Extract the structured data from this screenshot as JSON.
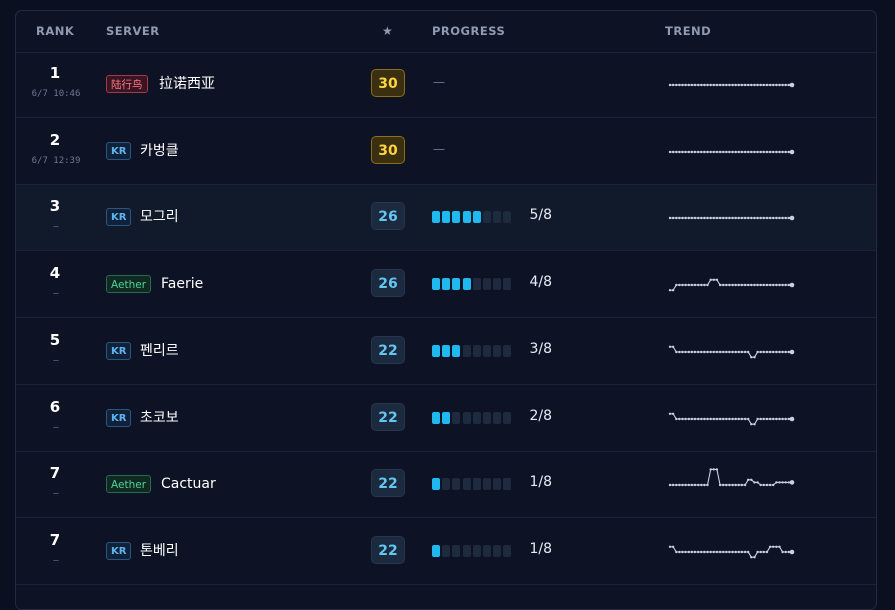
{
  "header": {
    "rank": "RANK",
    "server": "SERVER",
    "star": "★",
    "progress": "PROGRESS",
    "trend": "TREND"
  },
  "colors": {
    "bar_on": "#1fb8ef",
    "bar_off": "#1e2a3e",
    "trend_line": "#c9d0de",
    "gold": "#ffd23f",
    "blue": "#62c6ef"
  },
  "rows": [
    {
      "rank": "1",
      "time": "6/7 10:46",
      "badge": "陆行鸟",
      "badge_type": "cn",
      "server": "拉诺西亚",
      "score": "30",
      "score_type": "gold",
      "progress_text": "—",
      "progress_filled": null,
      "progress_total": 8,
      "highlight": false,
      "trend": [
        0,
        0,
        0,
        0,
        0,
        0,
        0,
        0,
        0,
        0,
        0,
        0,
        0,
        0,
        0,
        0,
        0,
        0,
        0,
        0,
        0,
        0,
        0,
        0,
        0,
        0,
        0,
        0,
        0,
        0,
        0,
        0,
        0,
        0,
        0,
        0,
        0,
        0,
        0,
        0
      ]
    },
    {
      "rank": "2",
      "time": "6/7 12:39",
      "badge": "KR",
      "badge_type": "kr",
      "server": "카벙클",
      "score": "30",
      "score_type": "gold",
      "progress_text": "—",
      "progress_filled": null,
      "progress_total": 8,
      "highlight": false,
      "trend": [
        0,
        0,
        0,
        0,
        0,
        0,
        0,
        0,
        0,
        0,
        0,
        0,
        0,
        0,
        0,
        0,
        0,
        0,
        0,
        0,
        0,
        0,
        0,
        0,
        0,
        0,
        0,
        0,
        0,
        0,
        0,
        0,
        0,
        0,
        0,
        0,
        0,
        0,
        0,
        0
      ]
    },
    {
      "rank": "3",
      "time": "—",
      "badge": "KR",
      "badge_type": "kr",
      "server": "모그리",
      "score": "26",
      "score_type": "blue",
      "progress_text": "5/8",
      "progress_filled": 5,
      "progress_total": 8,
      "highlight": true,
      "trend": [
        0,
        0,
        0,
        0,
        0,
        0,
        0,
        0,
        0,
        0,
        0,
        0,
        0,
        0,
        0,
        0,
        0,
        0,
        0,
        0,
        0,
        0,
        0,
        0,
        0,
        0,
        0,
        0,
        0,
        0,
        0,
        0,
        0,
        0,
        0,
        0,
        0,
        0,
        0,
        0
      ]
    },
    {
      "rank": "4",
      "time": "—",
      "badge": "Aether",
      "badge_type": "aether",
      "server": "Faerie",
      "score": "26",
      "score_type": "blue",
      "progress_text": "4/8",
      "progress_filled": 4,
      "progress_total": 8,
      "highlight": false,
      "trend": [
        -1,
        -1,
        0,
        0,
        0,
        0,
        0,
        0,
        0,
        0,
        0,
        0,
        0,
        1,
        1,
        1,
        0,
        0,
        0,
        0,
        0,
        0,
        0,
        0,
        0,
        0,
        0,
        0,
        0,
        0,
        0,
        0,
        0,
        0,
        0,
        0,
        0,
        0,
        0,
        0
      ]
    },
    {
      "rank": "5",
      "time": "—",
      "badge": "KR",
      "badge_type": "kr",
      "server": "펜리르",
      "score": "22",
      "score_type": "blue",
      "progress_text": "3/8",
      "progress_filled": 3,
      "progress_total": 8,
      "highlight": false,
      "trend": [
        1,
        1,
        0,
        0,
        0,
        0,
        0,
        0,
        0,
        0,
        0,
        0,
        0,
        0,
        0,
        0,
        0,
        0,
        0,
        0,
        0,
        0,
        0,
        0,
        0,
        0,
        -1,
        -1,
        0,
        0,
        0,
        0,
        0,
        0,
        0,
        0,
        0,
        0,
        0,
        0
      ]
    },
    {
      "rank": "6",
      "time": "—",
      "badge": "KR",
      "badge_type": "kr",
      "server": "초코보",
      "score": "22",
      "score_type": "blue",
      "progress_text": "2/8",
      "progress_filled": 2,
      "progress_total": 8,
      "highlight": false,
      "trend": [
        1,
        1,
        0,
        0,
        0,
        0,
        0,
        0,
        0,
        0,
        0,
        0,
        0,
        0,
        0,
        0,
        0,
        0,
        0,
        0,
        0,
        0,
        0,
        0,
        0,
        0,
        -1,
        -1,
        0,
        0,
        0,
        0,
        0,
        0,
        0,
        0,
        0,
        0,
        0,
        0
      ]
    },
    {
      "rank": "7",
      "time": "—",
      "badge": "Aether",
      "badge_type": "aether",
      "server": "Cactuar",
      "score": "22",
      "score_type": "blue",
      "progress_text": "1/8",
      "progress_filled": 1,
      "progress_total": 8,
      "highlight": false,
      "trend": [
        0,
        0,
        0,
        0,
        0,
        0,
        0,
        0,
        0,
        0,
        0,
        0,
        0,
        3,
        3,
        3,
        0,
        0,
        0,
        0,
        0,
        0,
        0,
        0,
        0,
        1,
        1,
        0.5,
        0.5,
        0,
        0,
        0,
        0,
        0,
        0.5,
        0.5,
        0.5,
        0.5,
        0.5,
        0.5
      ]
    },
    {
      "rank": "7",
      "time": "—",
      "badge": "KR",
      "badge_type": "kr",
      "server": "톤베리",
      "score": "22",
      "score_type": "blue",
      "progress_text": "1/8",
      "progress_filled": 1,
      "progress_total": 8,
      "highlight": false,
      "trend": [
        1,
        1,
        0,
        0,
        0,
        0,
        0,
        0,
        0,
        0,
        0,
        0,
        0,
        0,
        0,
        0,
        0,
        0,
        0,
        0,
        0,
        0,
        0,
        0,
        0,
        0,
        -1,
        -1,
        0,
        0,
        0,
        0,
        1,
        1,
        1,
        1,
        0,
        0,
        0,
        0
      ]
    }
  ]
}
